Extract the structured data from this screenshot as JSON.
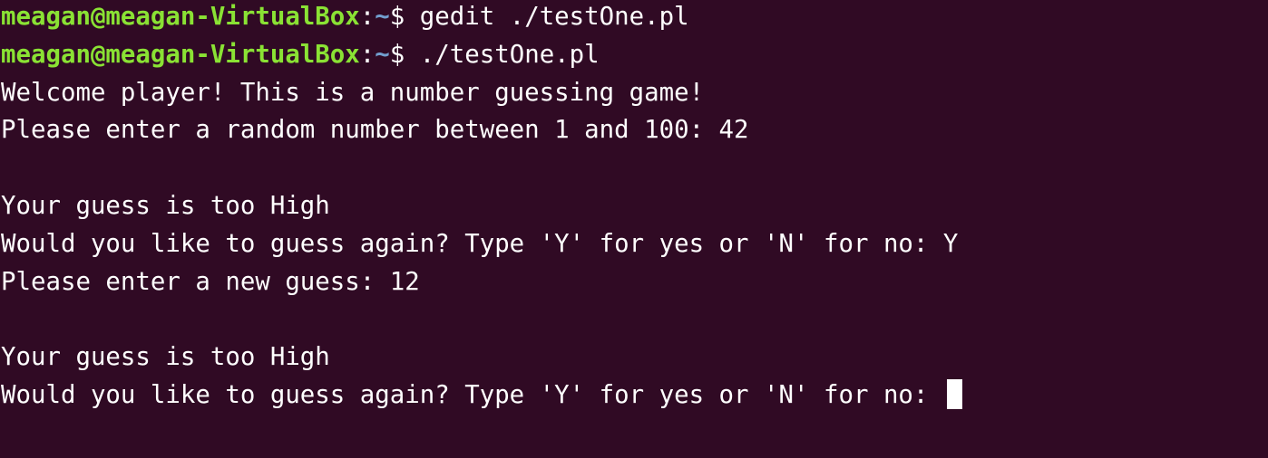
{
  "terminal": {
    "background": "#300a24",
    "foreground": "#ffffff",
    "prompt_user_color": "#8ae234",
    "prompt_path_color": "#729fcf",
    "prompt": {
      "user_host": "meagan@meagan-VirtualBox",
      "separator": ":",
      "path": "~",
      "symbol": "$ "
    },
    "lines": [
      {
        "type": "command",
        "text": "gedit ./testOne.pl"
      },
      {
        "type": "command",
        "text": "./testOne.pl"
      },
      {
        "type": "output",
        "text": "Welcome player! This is a number guessing game!"
      },
      {
        "type": "output",
        "text": "Please enter a random number between 1 and 100: 42"
      },
      {
        "type": "output",
        "text": ""
      },
      {
        "type": "output",
        "text": "Your guess is too High"
      },
      {
        "type": "output",
        "text": "Would you like to guess again? Type 'Y' for yes or 'N' for no: Y"
      },
      {
        "type": "output",
        "text": "Please enter a new guess: 12"
      },
      {
        "type": "output",
        "text": ""
      },
      {
        "type": "output",
        "text": "Your guess is too High"
      },
      {
        "type": "output",
        "text": "Would you like to guess again? Type 'Y' for yes or 'N' for no: "
      }
    ]
  }
}
